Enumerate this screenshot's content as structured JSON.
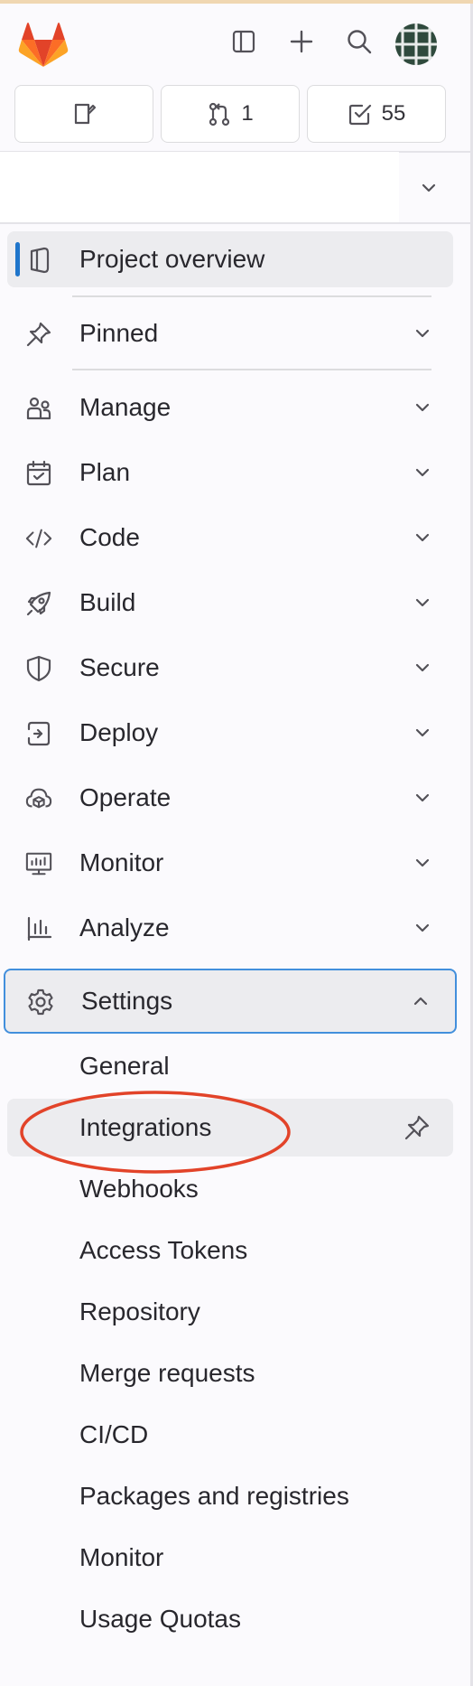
{
  "header": {
    "merge_requests_count": "1",
    "todos_count": "55"
  },
  "nav": {
    "project_overview": "Project overview",
    "pinned": "Pinned",
    "manage": "Manage",
    "plan": "Plan",
    "code": "Code",
    "build": "Build",
    "secure": "Secure",
    "deploy": "Deploy",
    "operate": "Operate",
    "monitor": "Monitor",
    "analyze": "Analyze",
    "settings": "Settings"
  },
  "settings_items": [
    "General",
    "Integrations",
    "Webhooks",
    "Access Tokens",
    "Repository",
    "Merge requests",
    "CI/CD",
    "Packages and registries",
    "Monitor",
    "Usage Quotas"
  ],
  "colors": {
    "accent": "#1f75cb",
    "focus_border": "#428fdc",
    "annotation": "#e24329",
    "logo_orange": "#e24329"
  }
}
